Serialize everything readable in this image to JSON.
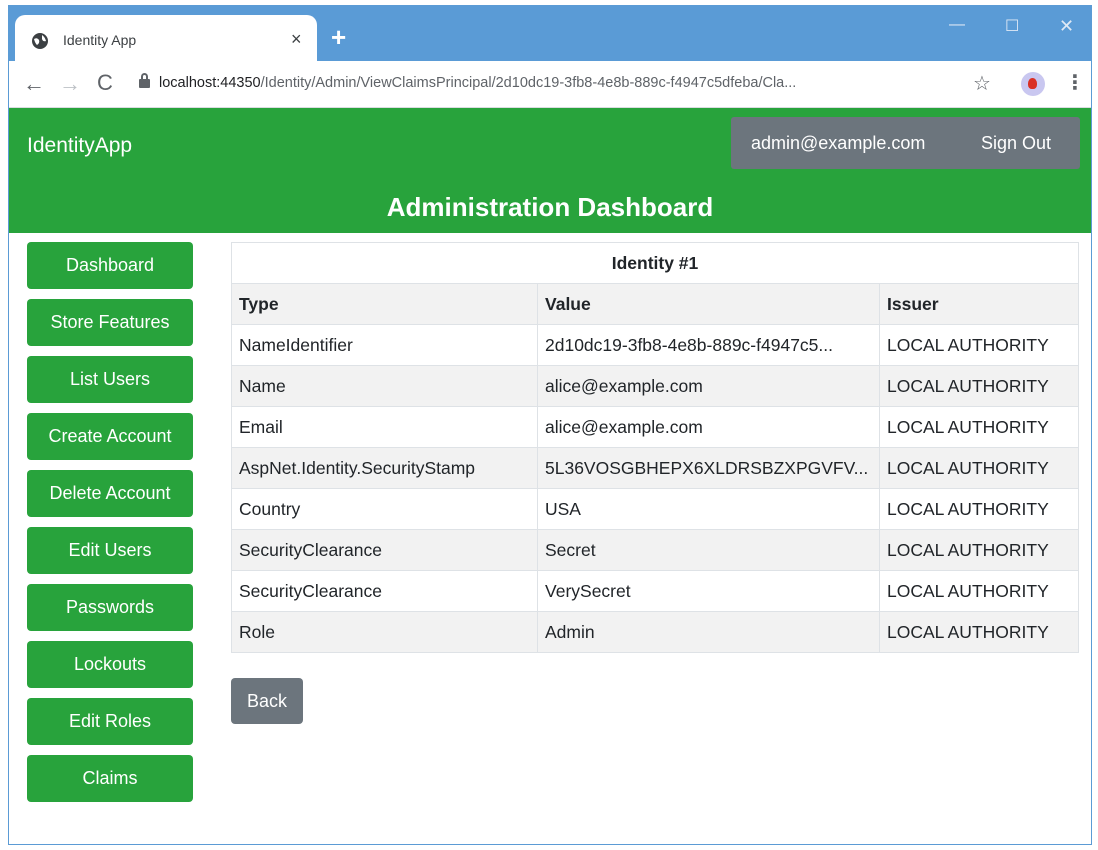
{
  "browser": {
    "tab_title": "Identity App",
    "tab_close": "×",
    "new_tab": "+",
    "win_min": "—",
    "win_max": "☐",
    "win_close": "✕",
    "url_host": "localhost:44350",
    "url_path": "/Identity/Admin/ViewClaimsPrincipal/2d10dc19-3fb8-4e8b-889c-f4947c5dfeba/Cla...",
    "back_glyph": "←",
    "forward_glyph": "→",
    "reload_glyph": "C",
    "star_glyph": "☆",
    "menu_glyph": "⋮"
  },
  "header": {
    "brand": "IdentityApp",
    "user_email": "admin@example.com",
    "signout_label": "Sign Out",
    "dashboard_title": "Administration Dashboard",
    "color_primary": "#28a33c",
    "color_secondary": "#6c757d"
  },
  "sidebar": {
    "items": [
      {
        "label": "Dashboard"
      },
      {
        "label": "Store Features"
      },
      {
        "label": "List Users"
      },
      {
        "label": "Create Account"
      },
      {
        "label": "Delete Account"
      },
      {
        "label": "Edit Users"
      },
      {
        "label": "Passwords"
      },
      {
        "label": "Lockouts"
      },
      {
        "label": "Edit Roles"
      },
      {
        "label": "Claims"
      }
    ]
  },
  "table": {
    "caption": "Identity #1",
    "columns": [
      "Type",
      "Value",
      "Issuer"
    ],
    "rows": [
      [
        "NameIdentifier",
        "2d10dc19-3fb8-4e8b-889c-f4947c5...",
        "LOCAL AUTHORITY"
      ],
      [
        "Name",
        "alice@example.com",
        "LOCAL AUTHORITY"
      ],
      [
        "Email",
        "alice@example.com",
        "LOCAL AUTHORITY"
      ],
      [
        "AspNet.Identity.SecurityStamp",
        "5L36VOSGBHEPX6XLDRSBZXPGVFV...",
        "LOCAL AUTHORITY"
      ],
      [
        "Country",
        "USA",
        "LOCAL AUTHORITY"
      ],
      [
        "SecurityClearance",
        "Secret",
        "LOCAL AUTHORITY"
      ],
      [
        "SecurityClearance",
        "VerySecret",
        "LOCAL AUTHORITY"
      ],
      [
        "Role",
        "Admin",
        "LOCAL AUTHORITY"
      ]
    ]
  },
  "back_label": "Back"
}
